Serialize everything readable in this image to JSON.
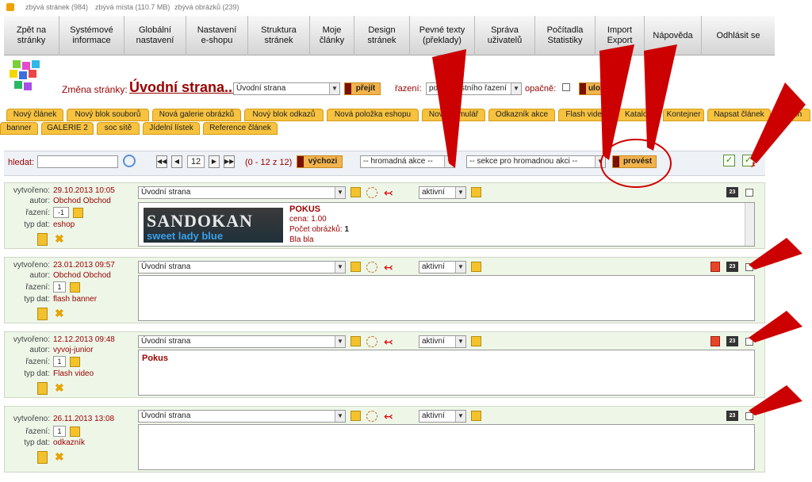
{
  "topstats": {
    "pages": "zbývá stránek (984)",
    "space": "zbývá místa (110.7 MB)",
    "images": "zbývá obrázků (239)"
  },
  "nav": [
    {
      "label": "Zpět na\nstránky"
    },
    {
      "label": "Systémové\ninformace"
    },
    {
      "label": "Globální\nnastavení"
    },
    {
      "label": "Nastavení\ne-shopu"
    },
    {
      "label": "Struktura\nstránek"
    },
    {
      "label": "Moje\nčlánky"
    },
    {
      "label": "Design\nstránek"
    },
    {
      "label": "Pevné texty\n(překlady)"
    },
    {
      "label": "Správa\nuživatelů"
    },
    {
      "label": "Počítadla\nStatistiky"
    },
    {
      "label": "Import\nExport"
    },
    {
      "label": "Nápověda"
    },
    {
      "label": "Odhlásit se"
    }
  ],
  "pagebar": {
    "label": "Změna stránky:",
    "title": "Úvodní strana...",
    "select": "Úvodní strana",
    "go": "přejít",
    "sort_label": "řazení:",
    "sort_value": "podle vlastního řazení",
    "reverse": "opačně:",
    "save": "uložit"
  },
  "tabs": [
    "Nový článek",
    "Nový blok souborů",
    "Nová galerie obrázků",
    "Nový blok odkazů",
    "Nová položka eshopu",
    "Nový formulář",
    "Odkazník akce",
    "Flash video",
    "Katalog",
    "Kontejner",
    "Napsat článek",
    "Flash",
    "banner",
    "GALERIE 2",
    "soc sítě",
    "Jídelní lístek",
    "Reference článek"
  ],
  "filter": {
    "search_label": "hledat:",
    "page_num": "12",
    "range": "(0 - 12 z 12)",
    "default": "výchozi",
    "bulk": "-- hromadná akce --",
    "section": "-- sekce pro hromadnou akci --",
    "run": "provést"
  },
  "labels": {
    "created": "vytvořeno:",
    "author": "autor:",
    "order": "řazení:",
    "type": "typ dat:"
  },
  "records": [
    {
      "created": "29.10.2013 10:05",
      "author": "Obchod Obchod",
      "order": "-1",
      "type": "eshop",
      "page": "Úvodní strana",
      "status": "aktivní",
      "banner": "SANDOKAN",
      "banner_sub": "sweet lady blue",
      "item_title": "POKUS",
      "item_price_label": "cena:",
      "item_price": "1.00",
      "item_images_label": "Počet obrázků:",
      "item_images": "1",
      "item_desc": "Bla bla"
    },
    {
      "created": "23.01.2013 09:57",
      "author": "Obchod Obchod",
      "order": "1",
      "type": "flash banner",
      "page": "Úvodní strana",
      "status": "aktivní"
    },
    {
      "created": "12.12.2013 09:48",
      "author": "vyvoj-junior",
      "order": "1",
      "type": "Flash video",
      "page": "Úvodní strana",
      "status": "aktivní",
      "text": "Pokus"
    },
    {
      "created": "26.11.2013 13:08",
      "order": "1",
      "type": "odkazník",
      "page": "Úvodní strana",
      "status": "aktivní"
    }
  ],
  "icons": {
    "search": "magnifier-icon",
    "first": "first-page-icon",
    "prev": "prev-page-icon",
    "next": "next-page-icon",
    "last": "last-page-icon",
    "calendar": "calendar-icon",
    "calendar_day": "23",
    "floppy": "save-icon",
    "tools": "tools-icon",
    "trash": "trash-icon",
    "usb": "usb-icon",
    "link": "link-icon",
    "flag": "red-flag-icon",
    "check": "check-all-icon",
    "uncheck": "uncheck-all-icon"
  },
  "colors": {
    "accent": "#900000",
    "tab": "#f6c23f",
    "button": "#f2b34c",
    "record_bg": "#eef6e8",
    "annotation": "#d00000"
  }
}
